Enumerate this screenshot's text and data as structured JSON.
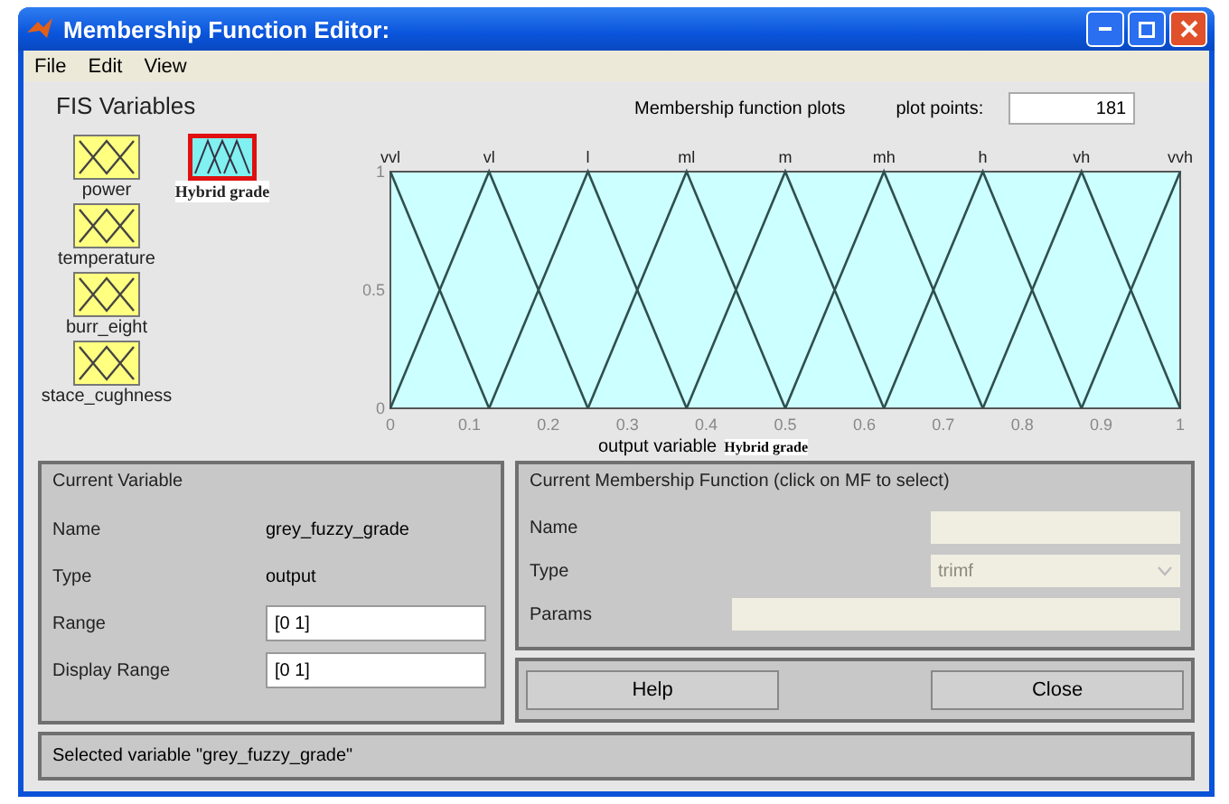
{
  "window": {
    "title": "Membership Function Editor:"
  },
  "menu": [
    "File",
    "Edit",
    "View"
  ],
  "fis_variables": {
    "title": "FIS Variables",
    "items": [
      {
        "name": "power",
        "kind": "input",
        "selected": false
      },
      {
        "name": "temperature",
        "kind": "input",
        "selected": false
      },
      {
        "name": "burr_eight",
        "kind": "input",
        "selected": false
      },
      {
        "name": "stace_cughness",
        "kind": "input",
        "selected": false
      },
      {
        "name": "Hybrid grade",
        "kind": "output",
        "selected": true
      }
    ]
  },
  "plot": {
    "title": "Membership function plots",
    "plot_points_label": "plot points:",
    "plot_points": "181",
    "variable_type": "output variable",
    "variable_name": "Hybrid grade",
    "chart_data": {
      "type": "line",
      "x": [
        0,
        0.125,
        0.25,
        0.375,
        0.5,
        0.625,
        0.75,
        0.875,
        1
      ],
      "xlim": [
        0,
        1
      ],
      "ylim": [
        0,
        1
      ],
      "xticks": [
        0,
        0.1,
        0.2,
        0.3,
        0.4,
        0.5,
        0.6,
        0.7,
        0.8,
        0.9,
        1
      ],
      "yticks": [
        0,
        0.5,
        1
      ],
      "series": [
        {
          "name": "vvl",
          "color": "#2f4f4f",
          "values": [
            1,
            0,
            null,
            null,
            null,
            null,
            null,
            null,
            null
          ]
        },
        {
          "name": "vl",
          "color": "#2f4f4f",
          "values": [
            0,
            1,
            0,
            null,
            null,
            null,
            null,
            null,
            null
          ]
        },
        {
          "name": "l",
          "color": "#2f4f4f",
          "values": [
            null,
            0,
            1,
            0,
            null,
            null,
            null,
            null,
            null
          ]
        },
        {
          "name": "ml",
          "color": "#2f4f4f",
          "values": [
            null,
            null,
            0,
            1,
            0,
            null,
            null,
            null,
            null
          ]
        },
        {
          "name": "m",
          "color": "#2f4f4f",
          "values": [
            null,
            null,
            null,
            0,
            1,
            0,
            null,
            null,
            null
          ]
        },
        {
          "name": "mh",
          "color": "#2f4f4f",
          "values": [
            null,
            null,
            null,
            null,
            0,
            1,
            0,
            null,
            null
          ]
        },
        {
          "name": "h",
          "color": "#2f4f4f",
          "values": [
            null,
            null,
            null,
            null,
            null,
            0,
            1,
            0,
            null
          ]
        },
        {
          "name": "vh",
          "color": "#2f4f4f",
          "values": [
            null,
            null,
            null,
            null,
            null,
            null,
            0,
            1,
            0
          ]
        },
        {
          "name": "vvh",
          "color": "#2f4f4f",
          "values": [
            null,
            null,
            null,
            null,
            null,
            null,
            null,
            0,
            1
          ]
        }
      ]
    }
  },
  "current_variable": {
    "title": "Current Variable",
    "rows": [
      {
        "label": "Name",
        "value": "grey_fuzzy_grade",
        "kind": "text"
      },
      {
        "label": "Type",
        "value": "output",
        "kind": "text"
      },
      {
        "label": "Range",
        "value": "[0 1]",
        "kind": "field"
      },
      {
        "label": "Display Range",
        "value": "[0 1]",
        "kind": "field"
      }
    ]
  },
  "current_mf": {
    "title": "Current Membership Function (click on MF to select)",
    "name_label": "Name",
    "type_label": "Type",
    "type_value": "trimf",
    "params_label": "Params",
    "disabled": true
  },
  "buttons": [
    "Help",
    "Close"
  ],
  "status_bar": "Selected variable \"grey_fuzzy_grade\""
}
